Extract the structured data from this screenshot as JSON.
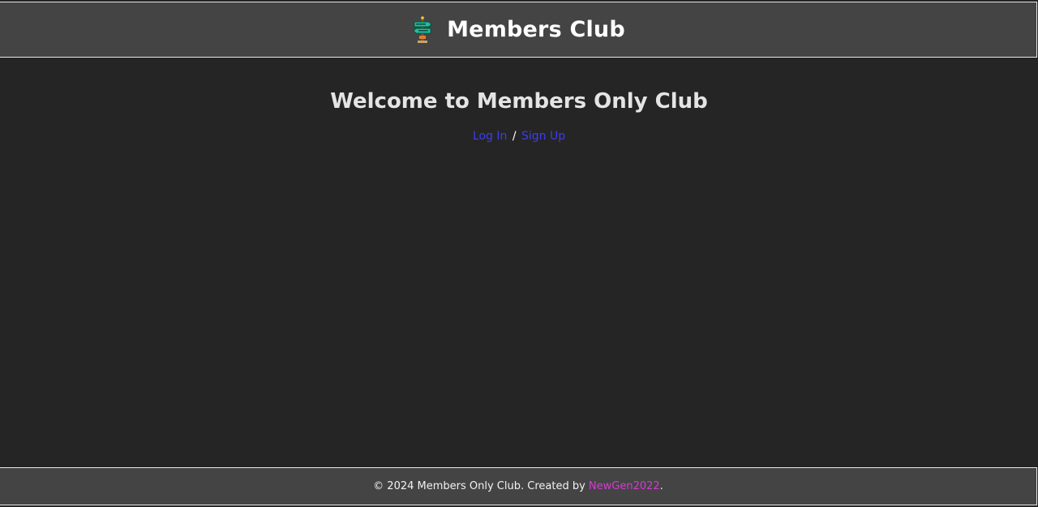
{
  "header": {
    "logo_icon": "signpost-icon",
    "title": "Members Club"
  },
  "main": {
    "welcome_heading": "Welcome to Members Only Club",
    "login_link": "Log In",
    "separator": "/",
    "signup_link": "Sign Up"
  },
  "footer": {
    "copyright_text": "© 2024 Members Only Club. Created by",
    "creator_link": "NewGen2022",
    "end_period": "."
  },
  "colors": {
    "background": "#252525",
    "bar": "#444444",
    "link": "#3d3df0",
    "creator_link": "#d63ad6"
  }
}
